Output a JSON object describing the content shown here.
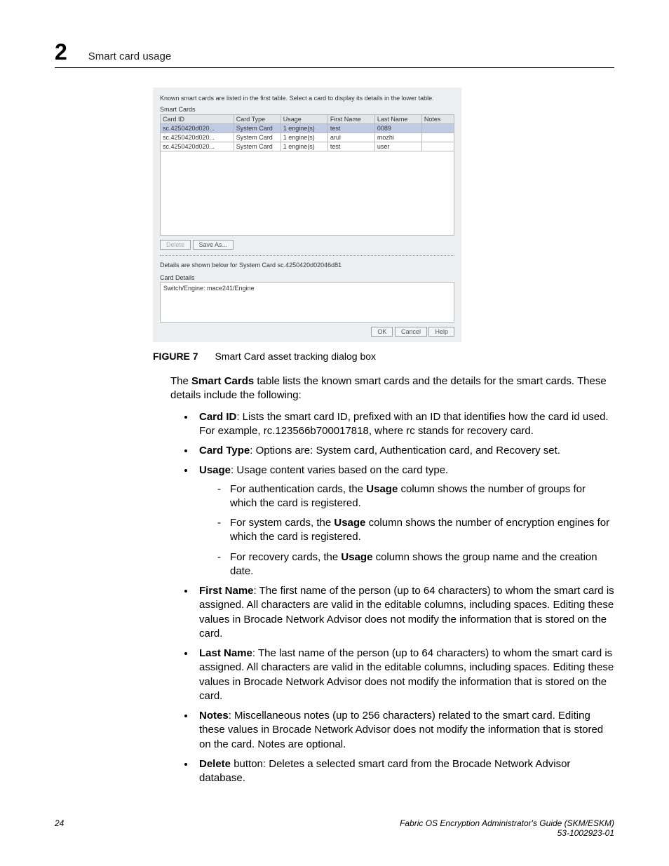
{
  "header": {
    "chapter_number": "2",
    "chapter_title": "Smart card usage"
  },
  "shot": {
    "instruction": "Known smart cards are listed in the first table. Select a card to display its details in the lower table.",
    "table_caption": "Smart Cards",
    "cols": [
      "Card ID",
      "Card Type",
      "Usage",
      "First Name",
      "Last Name",
      "Notes"
    ],
    "rows": [
      {
        "sel": true,
        "c": [
          "sc.4250420d020...",
          "System Card",
          "1 engine(s)",
          "test",
          "0089",
          ""
        ]
      },
      {
        "sel": false,
        "c": [
          "sc.4250420d020...",
          "System Card",
          "1 engine(s)",
          "arul",
          "mozhi",
          ""
        ]
      },
      {
        "sel": false,
        "c": [
          "sc.4250420d020...",
          "System Card",
          "1 engine(s)",
          "test",
          "user",
          ""
        ]
      }
    ],
    "btn_delete": "Delete",
    "btn_saveas": "Save As...",
    "details_line": "Details are shown below for System Card sc.4250420d02046d81",
    "details_caption": "Card Details",
    "panel_line": "Switch/Engine: mace241/Engine",
    "btn_ok": "OK",
    "btn_cancel": "Cancel",
    "btn_help": "Help"
  },
  "figure": {
    "label": "FIGURE 7",
    "caption": "Smart Card asset tracking dialog box"
  },
  "para_intro_a": "The ",
  "para_intro_b": "Smart Cards",
  "para_intro_c": " table lists the known smart cards and the details for the smart cards. These details include the following:",
  "items": {
    "card_id": {
      "h": "Card ID",
      "t": ": Lists the smart card ID, prefixed with an ID that identifies how the card id used. For example, rc.123566b700017818, where rc stands for recovery card."
    },
    "card_type": {
      "h": "Card Type",
      "t": ": Options are: System card, Authentication card, and Recovery set."
    },
    "usage": {
      "h": "Usage",
      "t": ": Usage content varies based on the card type."
    },
    "usage_sub": {
      "auth_a": "For authentication cards, the ",
      "auth_b": "Usage",
      "auth_c": " column shows the number of groups for which the card is registered.",
      "sys_a": "For system cards, the ",
      "sys_b": "Usage",
      "sys_c": " column shows the number of encryption engines for which the card is registered.",
      "rec_a": "For recovery cards, the ",
      "rec_b": "Usage",
      "rec_c": " column shows the group name and the creation date."
    },
    "first": {
      "h": "First Name",
      "t": ": The first name of the person (up to 64 characters) to whom the smart card is assigned. All characters are valid in the editable columns, including spaces. Editing these values in Brocade Network Advisor does not modify the information that is stored on the card."
    },
    "last": {
      "h": "Last Name",
      "t": ": The last name of the person (up to 64 characters) to whom the smart card is assigned. All characters are valid in the editable columns, including spaces. Editing these values in Brocade Network Advisor does not modify the information that is stored on the card."
    },
    "notes": {
      "h": "Notes",
      "t": ": Miscellaneous notes (up to 256 characters) related to the smart card. Editing these values in Brocade Network Advisor does not modify the information that is stored on the card. Notes are optional."
    },
    "delete": {
      "h": "Delete",
      "t": " button: Deletes a selected smart card from the Brocade Network Advisor database."
    }
  },
  "footer": {
    "page": "24",
    "title": "Fabric OS Encryption Administrator's Guide (SKM/ESKM)",
    "docnum": "53-1002923-01"
  }
}
